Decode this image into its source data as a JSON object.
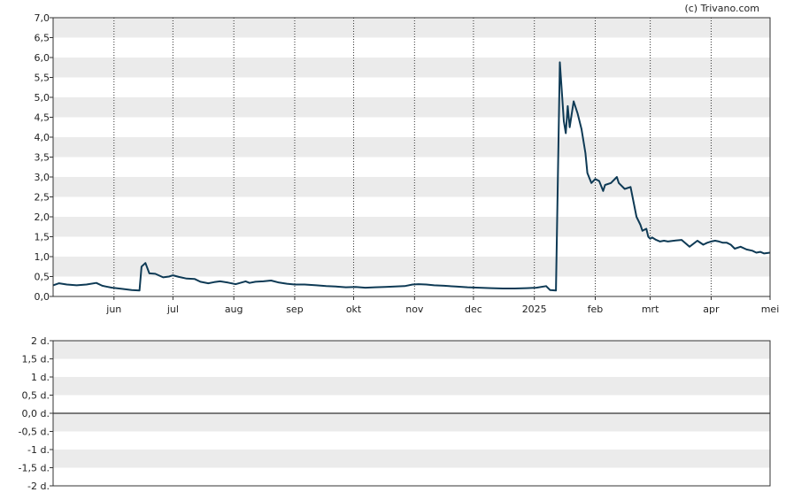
{
  "credit": "(c) Trivano.com",
  "colors": {
    "line": "#0e3a55",
    "band": "#ebebeb",
    "frame": "#333333",
    "vgrid": "#333333",
    "zero": "#000000"
  },
  "chart_data": [
    {
      "type": "line",
      "ylim": [
        0,
        7
      ],
      "ytick_labels": [
        "0,0",
        "0,5",
        "1,0",
        "1,5",
        "2,0",
        "2,5",
        "3,0",
        "3,5",
        "4,0",
        "4,5",
        "5,0",
        "5,5",
        "6,0",
        "6,5",
        "7,0"
      ],
      "xlim": [
        "2024-05-01",
        "2025-05-01"
      ],
      "xticks": [
        {
          "label": "jun",
          "date": "2024-06-01"
        },
        {
          "label": "jul",
          "date": "2024-07-01"
        },
        {
          "label": "aug",
          "date": "2024-08-01"
        },
        {
          "label": "sep",
          "date": "2024-09-01"
        },
        {
          "label": "okt",
          "date": "2024-10-01"
        },
        {
          "label": "nov",
          "date": "2024-11-01"
        },
        {
          "label": "dec",
          "date": "2024-12-01"
        },
        {
          "label": "2025",
          "date": "2025-01-01"
        },
        {
          "label": "feb",
          "date": "2025-02-01"
        },
        {
          "label": "mrt",
          "date": "2025-03-01"
        },
        {
          "label": "apr",
          "date": "2025-04-01"
        },
        {
          "label": "mei",
          "date": "2025-05-01"
        }
      ],
      "grid": "alternating-bands",
      "series": [
        {
          "x": [
            "2024-05-01",
            "2024-05-04",
            "2024-05-08",
            "2024-05-13",
            "2024-05-18",
            "2024-05-23",
            "2024-05-26",
            "2024-05-28",
            "2024-05-31",
            "2024-06-05",
            "2024-06-10",
            "2024-06-14",
            "2024-06-15",
            "2024-06-17",
            "2024-06-19",
            "2024-06-22",
            "2024-06-26",
            "2024-06-29",
            "2024-07-01",
            "2024-07-04",
            "2024-07-08",
            "2024-07-12",
            "2024-07-15",
            "2024-07-19",
            "2024-07-22",
            "2024-07-25",
            "2024-07-29",
            "2024-08-02",
            "2024-08-07",
            "2024-08-09",
            "2024-08-12",
            "2024-08-16",
            "2024-08-20",
            "2024-08-24",
            "2024-08-28",
            "2024-09-01",
            "2024-09-06",
            "2024-09-12",
            "2024-09-17",
            "2024-09-22",
            "2024-09-27",
            "2024-10-02",
            "2024-10-07",
            "2024-10-12",
            "2024-10-17",
            "2024-10-22",
            "2024-10-27",
            "2024-10-31",
            "2024-11-03",
            "2024-11-07",
            "2024-11-11",
            "2024-11-16",
            "2024-11-22",
            "2024-11-28",
            "2024-12-04",
            "2024-12-10",
            "2024-12-16",
            "2024-12-22",
            "2024-12-28",
            "2025-01-02",
            "2025-01-07",
            "2025-01-09",
            "2025-01-12",
            "2025-01-14",
            "2025-01-16",
            "2025-01-17",
            "2025-01-18",
            "2025-01-19",
            "2025-01-21",
            "2025-01-23",
            "2025-01-25",
            "2025-01-27",
            "2025-01-28",
            "2025-01-30",
            "2025-02-01",
            "2025-02-03",
            "2025-02-05",
            "2025-02-06",
            "2025-02-09",
            "2025-02-12",
            "2025-02-13",
            "2025-02-16",
            "2025-02-19",
            "2025-02-22",
            "2025-02-24",
            "2025-02-25",
            "2025-02-27",
            "2025-02-28",
            "2025-03-01",
            "2025-03-02",
            "2025-03-04",
            "2025-03-06",
            "2025-03-08",
            "2025-03-10",
            "2025-03-13",
            "2025-03-17",
            "2025-03-21",
            "2025-03-25",
            "2025-03-28",
            "2025-03-30",
            "2025-04-01",
            "2025-04-03",
            "2025-04-05",
            "2025-04-07",
            "2025-04-09",
            "2025-04-11",
            "2025-04-13",
            "2025-04-16",
            "2025-04-19",
            "2025-04-22",
            "2025-04-24",
            "2025-04-26",
            "2025-04-28",
            "2025-05-01"
          ],
          "values": [
            0.28,
            0.33,
            0.3,
            0.28,
            0.3,
            0.34,
            0.27,
            0.25,
            0.22,
            0.19,
            0.16,
            0.15,
            0.75,
            0.84,
            0.58,
            0.57,
            0.48,
            0.5,
            0.53,
            0.49,
            0.45,
            0.44,
            0.37,
            0.33,
            0.36,
            0.38,
            0.35,
            0.31,
            0.38,
            0.34,
            0.37,
            0.38,
            0.4,
            0.35,
            0.32,
            0.3,
            0.3,
            0.28,
            0.26,
            0.25,
            0.23,
            0.24,
            0.22,
            0.23,
            0.24,
            0.25,
            0.26,
            0.3,
            0.31,
            0.3,
            0.28,
            0.27,
            0.25,
            0.23,
            0.22,
            0.21,
            0.2,
            0.2,
            0.21,
            0.22,
            0.26,
            0.16,
            0.15,
            5.88,
            4.4,
            4.1,
            4.78,
            4.25,
            4.9,
            4.6,
            4.2,
            3.6,
            3.1,
            2.85,
            2.95,
            2.9,
            2.65,
            2.8,
            2.85,
            3.0,
            2.85,
            2.7,
            2.75,
            2.0,
            1.8,
            1.65,
            1.7,
            1.5,
            1.45,
            1.48,
            1.42,
            1.38,
            1.4,
            1.38,
            1.4,
            1.42,
            1.25,
            1.4,
            1.3,
            1.35,
            1.38,
            1.4,
            1.38,
            1.35,
            1.35,
            1.3,
            1.2,
            1.25,
            1.18,
            1.15,
            1.1,
            1.12,
            1.08,
            1.1
          ]
        }
      ]
    },
    {
      "type": "line",
      "ylim": [
        -2,
        2
      ],
      "ytick_labels": [
        "-2 d.",
        "-1,5 d.",
        "-1 d.",
        "-0,5 d.",
        "0,0 d.",
        "0,5 d.",
        "1 d.",
        "1,5 d.",
        "2 d."
      ],
      "grid": "alternating-bands",
      "series": []
    }
  ]
}
